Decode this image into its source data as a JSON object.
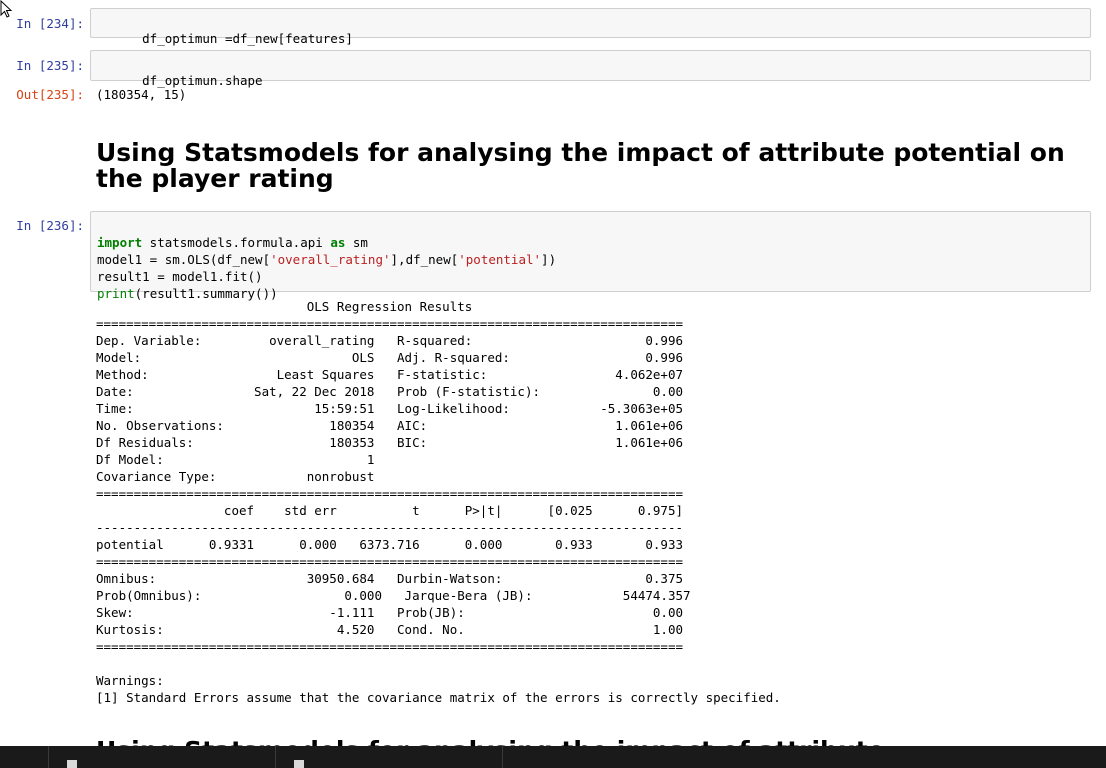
{
  "cells": {
    "c234": {
      "prompt": "In [234]:",
      "code": "df_optimun =df_new[features]"
    },
    "c235": {
      "prompt": "In [235]:",
      "code": "df_optimun.shape",
      "out_prompt": "Out[235]:",
      "output": "(180354, 15)"
    },
    "heading": "Using Statsmodels for analysing the impact of attribute potential on the player rating",
    "c236": {
      "prompt": "In [236]:",
      "line1_kw1": "import",
      "line1_mid": " statsmodels.formula.api ",
      "line1_kw2": "as",
      "line1_end": " sm",
      "line2_a": "model1 = sm.OLS(df_new[",
      "line2_s1": "'overall_rating'",
      "line2_b": "],df_new[",
      "line2_s2": "'potential'",
      "line2_c": "])",
      "line3": "result1 = model1.fit()",
      "line4_fn": "print",
      "line4_rest": "(result1.summary())"
    }
  },
  "summary": {
    "lines": [
      "                            OLS Regression Results                            ",
      "==============================================================================",
      "Dep. Variable:         overall_rating   R-squared:                       0.996",
      "Model:                            OLS   Adj. R-squared:                  0.996",
      "Method:                 Least Squares   F-statistic:                 4.062e+07",
      "Date:                Sat, 22 Dec 2018   Prob (F-statistic):               0.00",
      "Time:                        15:59:51   Log-Likelihood:            -5.3063e+05",
      "No. Observations:              180354   AIC:                         1.061e+06",
      "Df Residuals:                  180353   BIC:                         1.061e+06",
      "Df Model:                           1                                         ",
      "Covariance Type:            nonrobust                                         ",
      "==============================================================================",
      "                 coef    std err          t      P>|t|      [0.025      0.975]",
      "------------------------------------------------------------------------------",
      "potential      0.9331      0.000   6373.716      0.000       0.933       0.933",
      "==============================================================================",
      "Omnibus:                    30950.684   Durbin-Watson:                   0.375",
      "Prob(Omnibus):                   0.000   Jarque-Bera (JB):            54474.357",
      "Skew:                          -1.111   Prob(JB):                         0.00",
      "Kurtosis:                       4.520   Cond. No.                         1.00",
      "==============================================================================",
      "",
      "Warnings:",
      "[1] Standard Errors assume that the covariance matrix of the errors is correctly specified."
    ]
  },
  "next_heading_peek": "Using Statsmodels for analysing the impact of attribute"
}
